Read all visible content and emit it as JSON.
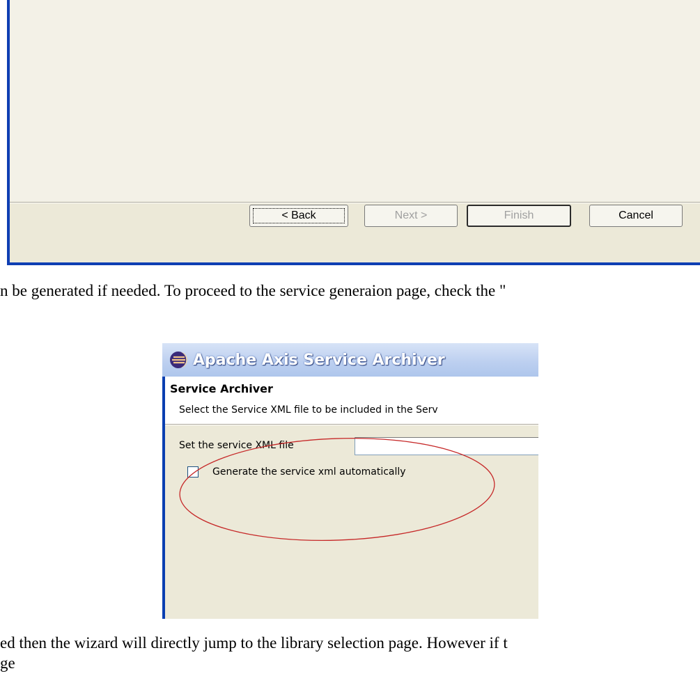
{
  "top_dialog": {
    "buttons": {
      "back": "< Back",
      "next": "Next >",
      "finish": "Finish",
      "cancel": "Cancel"
    }
  },
  "paragraphs": {
    "p1": "n be generated if needed. To proceed to the service generaion page, check the \"",
    "p3_line1": "ed then the wizard will directly jump to the library selection page. However if t",
    "p3_line2": "ge"
  },
  "screenshot": {
    "title": "Apache Axis Service Archiver",
    "heading": "Service Archiver",
    "description": "Select the Service XML file to be included in the Serv",
    "xml_label": "Set the service XML file",
    "xml_value": "",
    "checkbox_label": "Generate the service xml automatically",
    "checkbox_checked": false,
    "annotation_color": "#c62828",
    "title_icon": "eclipse-icon"
  }
}
